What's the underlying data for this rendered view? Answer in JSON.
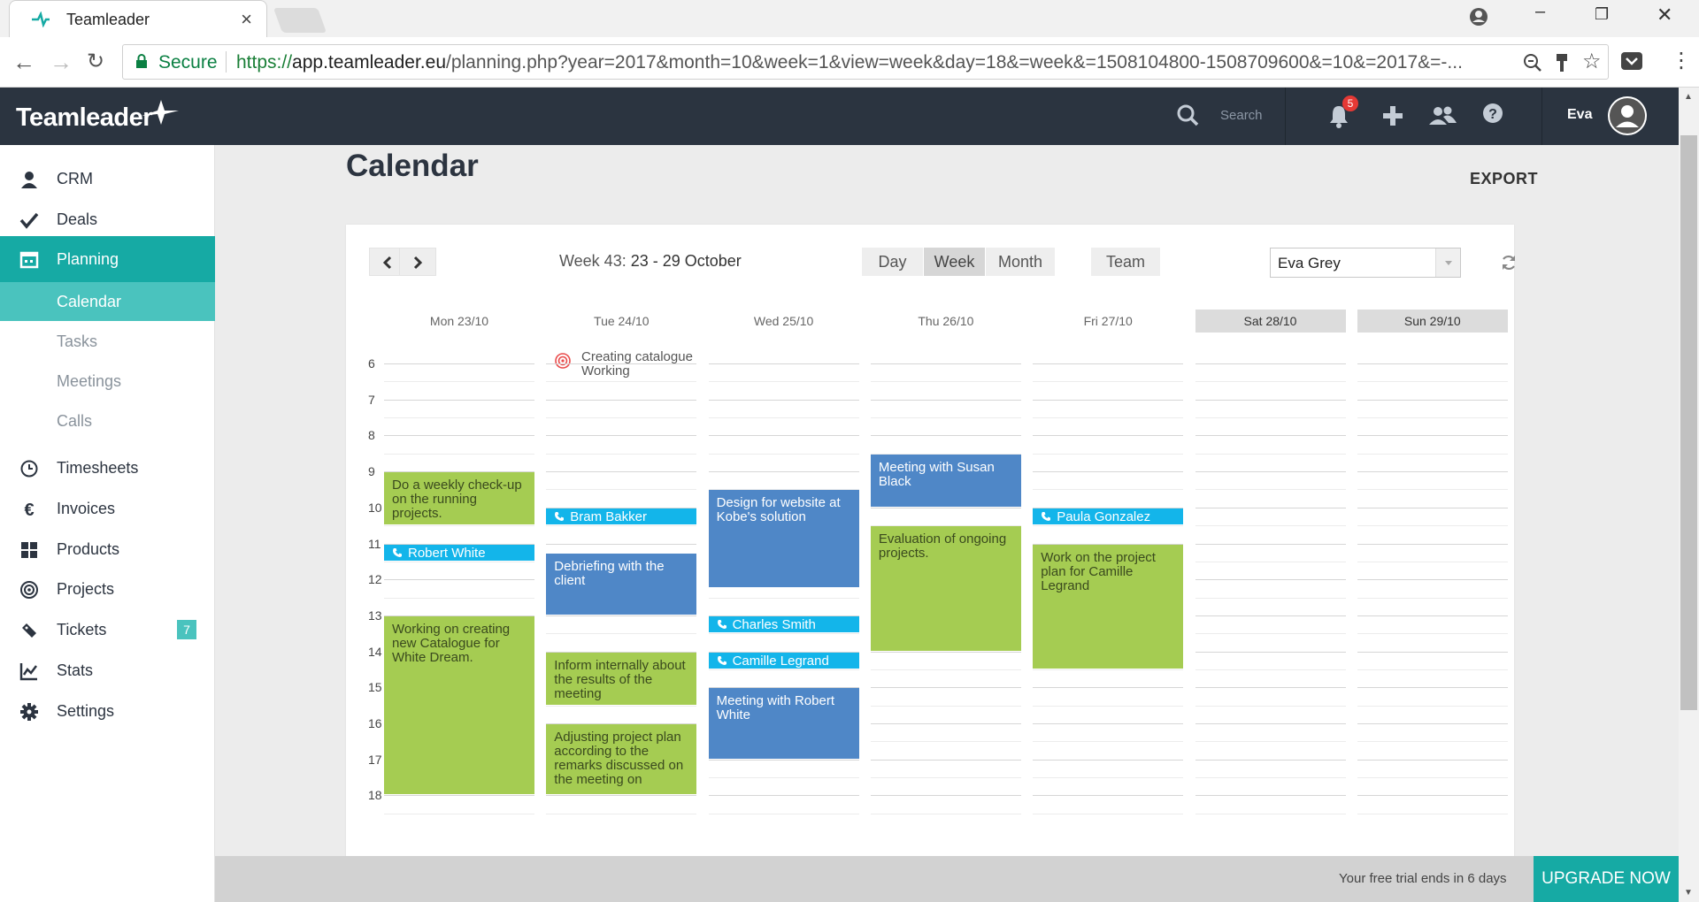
{
  "browser": {
    "tab_title": "Teamleader",
    "secure_label": "Secure",
    "url_scheme": "https://",
    "url_host": "app.teamleader.eu",
    "url_path": "/planning.php?year=2017&month=10&week=1&view=week&day=18&=week&=1508104800-1508709600&=10&=2017&=-..."
  },
  "header": {
    "logo": "Teamleader",
    "search_placeholder": "Search",
    "notification_count": "5",
    "username": "Eva"
  },
  "sidebar": {
    "items": [
      {
        "label": "CRM",
        "icon": "person-icon"
      },
      {
        "label": "Deals",
        "icon": "check-icon"
      },
      {
        "label": "Planning",
        "icon": "calendar-icon"
      },
      {
        "label": "Timesheets",
        "icon": "clock-icon"
      },
      {
        "label": "Invoices",
        "icon": "euro-icon"
      },
      {
        "label": "Products",
        "icon": "grid-icon"
      },
      {
        "label": "Projects",
        "icon": "target-icon"
      },
      {
        "label": "Tickets",
        "icon": "ticket-icon",
        "badge": "7"
      },
      {
        "label": "Stats",
        "icon": "chart-icon"
      },
      {
        "label": "Settings",
        "icon": "gear-icon"
      }
    ],
    "planning_sub": [
      "Calendar",
      "Tasks",
      "Meetings",
      "Calls"
    ]
  },
  "page": {
    "title": "Calendar",
    "export": "EXPORT"
  },
  "toolbar": {
    "week_prefix": "Week 43:",
    "week_dates": "23 - 29 October",
    "views": [
      "Day",
      "Week",
      "Month"
    ],
    "active_view": "Week",
    "team": "Team",
    "selected_user": "Eva Grey"
  },
  "days": [
    "Mon 23/10",
    "Tue 24/10",
    "Wed 25/10",
    "Thu 26/10",
    "Fri 27/10",
    "Sat 28/10",
    "Sun 29/10"
  ],
  "allday_event": {
    "day": 1,
    "text": "Creating catalogue Working"
  },
  "hours": [
    "6",
    "7",
    "8",
    "9",
    "10",
    "11",
    "12",
    "13",
    "14",
    "15",
    "16",
    "17",
    "18"
  ],
  "events": [
    {
      "day": 0,
      "type": "green",
      "start": 9.0,
      "end": 10.5,
      "text": "Do a weekly check-up on the running projects."
    },
    {
      "day": 0,
      "type": "call",
      "start": 11.0,
      "end": 11.5,
      "text": "Robert White"
    },
    {
      "day": 0,
      "type": "green",
      "start": 13.0,
      "end": 18.0,
      "text": "Working on creating new Catalogue for White Dream."
    },
    {
      "day": 1,
      "type": "call",
      "start": 10.0,
      "end": 10.5,
      "text": "Bram Bakker"
    },
    {
      "day": 1,
      "type": "blue",
      "start": 11.25,
      "end": 13.0,
      "text": "Debriefing with the client"
    },
    {
      "day": 1,
      "type": "green",
      "start": 14.0,
      "end": 15.5,
      "text": "Inform internally about the results of the meeting"
    },
    {
      "day": 1,
      "type": "green",
      "start": 16.0,
      "end": 18.0,
      "text": "Adjusting project plan according to the remarks discussed on the meeting on"
    },
    {
      "day": 2,
      "type": "blue",
      "start": 9.5,
      "end": 12.25,
      "text": "Design for website at Kobe's solution"
    },
    {
      "day": 2,
      "type": "call",
      "start": 13.0,
      "end": 13.5,
      "text": "Charles Smith"
    },
    {
      "day": 2,
      "type": "call",
      "start": 14.0,
      "end": 14.5,
      "text": "Camille Legrand"
    },
    {
      "day": 2,
      "type": "blue",
      "start": 15.0,
      "end": 17.0,
      "text": "Meeting with Robert White"
    },
    {
      "day": 3,
      "type": "blue",
      "start": 8.5,
      "end": 10.0,
      "text": "Meeting with Susan Black"
    },
    {
      "day": 3,
      "type": "green",
      "start": 10.5,
      "end": 14.0,
      "text": "Evaluation of ongoing projects."
    },
    {
      "day": 4,
      "type": "call",
      "start": 10.0,
      "end": 10.5,
      "text": "Paula Gonzalez"
    },
    {
      "day": 4,
      "type": "green",
      "start": 11.0,
      "end": 14.5,
      "text": "Work on the project plan for Camille Legrand"
    }
  ],
  "footer": {
    "trial_text": "Your free trial ends in 6 days",
    "upgrade": "UPGRADE NOW"
  },
  "colors": {
    "accent": "#16aaa4",
    "accent_light": "#4ac3be",
    "header_bg": "#2b3440",
    "event_green": "#a5cc52",
    "event_blue": "#4f87c7",
    "event_call": "#13b5ea"
  }
}
